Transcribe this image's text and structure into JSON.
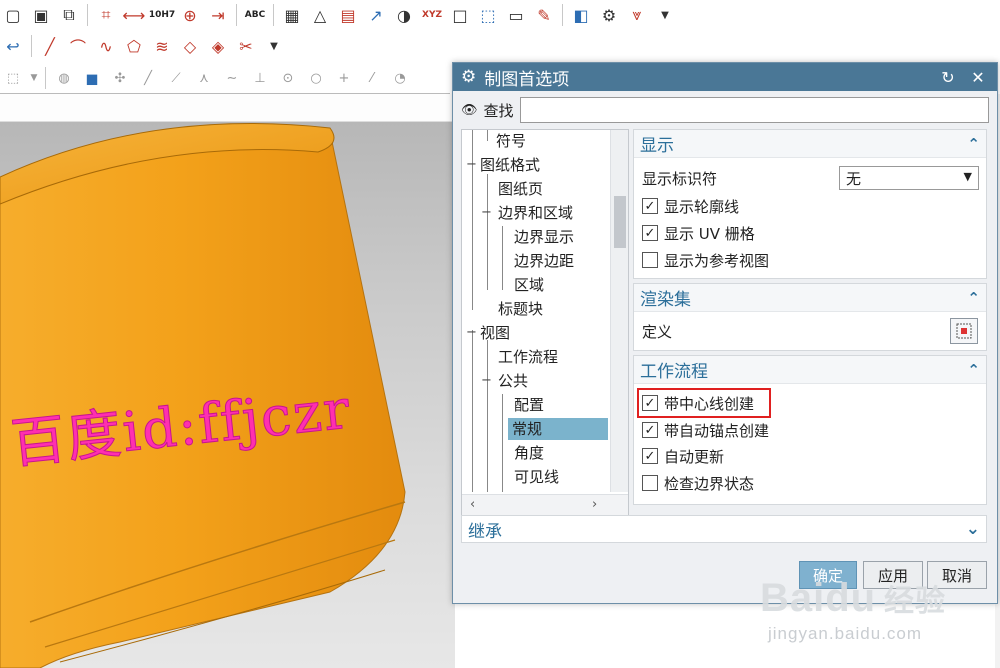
{
  "toolbar": {
    "row1": [
      "frame-icon",
      "sheet-icon",
      "arrow-view-icon",
      "dimension-icon",
      "rapid-dim-icon",
      "tolerance-icon",
      "datum-icon",
      "position-icon",
      "abc-note-icon",
      "table-icon",
      "triangle-icon",
      "grid-icon",
      "leader-icon",
      "pie-icon",
      "xyz-icon",
      "blank-icon",
      "balloon-icon",
      "doc-icon",
      "brush-icon",
      "settings-app-icon",
      "gear-icon",
      "drafting-icon"
    ],
    "label_10h7": "10H7",
    "label_abc": "ABC",
    "label_xyz": "XYZ"
  },
  "viewport": {
    "watermark_text": "百度id:ffjczr"
  },
  "dialog": {
    "title": "制图首选项",
    "search_label": "查找",
    "search_value": "",
    "tree": [
      {
        "label": "符号",
        "level": 2
      },
      {
        "label": "图纸格式",
        "level": 0
      },
      {
        "label": "图纸页",
        "level": 1
      },
      {
        "label": "边界和区域",
        "level": 1
      },
      {
        "label": "边界显示",
        "level": 2
      },
      {
        "label": "边界边距",
        "level": 2
      },
      {
        "label": "区域",
        "level": 2
      },
      {
        "label": "标题块",
        "level": 1
      },
      {
        "label": "视图",
        "level": 0
      },
      {
        "label": "工作流程",
        "level": 1
      },
      {
        "label": "公共",
        "level": 1
      },
      {
        "label": "配置",
        "level": 2
      },
      {
        "label": "常规",
        "level": 2,
        "selected": true
      },
      {
        "label": "角度",
        "level": 2
      },
      {
        "label": "可见线",
        "level": 2
      }
    ],
    "display_panel": {
      "title": "显示",
      "identifier_label": "显示标识符",
      "identifier_value": "无",
      "checkboxes": [
        {
          "label": "显示轮廓线",
          "checked": true
        },
        {
          "label": "显示 UV 栅格",
          "checked": true
        },
        {
          "label": "显示为参考视图",
          "checked": false
        }
      ]
    },
    "render_panel": {
      "title": "渲染集",
      "define_label": "定义"
    },
    "workflow_panel": {
      "title": "工作流程",
      "checkboxes": [
        {
          "label": "带中心线创建",
          "checked": true
        },
        {
          "label": "带自动锚点创建",
          "checked": true
        },
        {
          "label": "自动更新",
          "checked": true
        },
        {
          "label": "检查边界状态",
          "checked": false
        }
      ]
    },
    "inherit_label": "继承",
    "buttons": {
      "ok": "确定",
      "apply": "应用",
      "cancel": "取消"
    }
  },
  "watermark": {
    "logo": "Baidu",
    "logo_cn": "经验",
    "sub": "jingyan.baidu.com"
  },
  "colors": {
    "mug": "#f4a11c",
    "title_bar": "#4a7796",
    "selection": "#7bb3cc",
    "highlight": "#e02020",
    "pink_text": "#ff2fb0"
  }
}
